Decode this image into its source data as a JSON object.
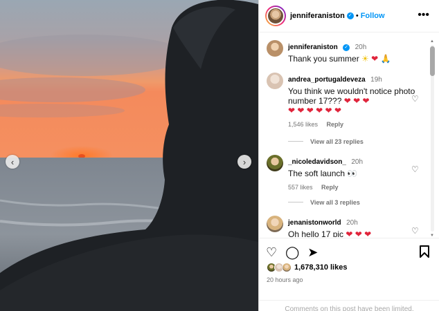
{
  "post": {
    "author": "jenniferaniston",
    "follow_label": "Follow",
    "separator": "•",
    "more_icon": "more-horizontal-icon",
    "caption": {
      "username": "jenniferaniston",
      "time": "20h",
      "text": "Thank you summer",
      "emojis": [
        "☀",
        "❤",
        "🙏"
      ]
    }
  },
  "photo": {
    "prev_icon": "‹",
    "next_icon": "›"
  },
  "comments": [
    {
      "username": "andrea_portugaldeveza",
      "time": "19h",
      "text": "You think we wouldn't notice photo number 17???",
      "hearts": "❤ ❤ ❤",
      "hearts_line2": "❤ ❤ ❤ ❤ ❤ ❤",
      "likes": "1,546 likes",
      "reply_label": "Reply",
      "view_replies": "View all 23 replies"
    },
    {
      "username": "_nicoledavidson_",
      "time": "20h",
      "text": "The soft launch",
      "eyes": "👀",
      "likes": "557 likes",
      "reply_label": "Reply",
      "view_replies": "View all 3 replies"
    },
    {
      "username": "jenanistonworld",
      "time": "20h",
      "text": "Oh hello 17 pic",
      "hearts": "❤ ❤ ❤"
    }
  ],
  "actions": {
    "like_icon": "♡",
    "comment_icon": "◯",
    "share_icon": "➤",
    "save_icon": "🔖",
    "likes_count": "1,678,310 likes",
    "posted_ago": "20 hours ago",
    "comments_limited": "Comments on this post have been limited."
  },
  "colors": {
    "accent": "#0095f6",
    "heart": "#e0243b",
    "muted": "#737373"
  }
}
